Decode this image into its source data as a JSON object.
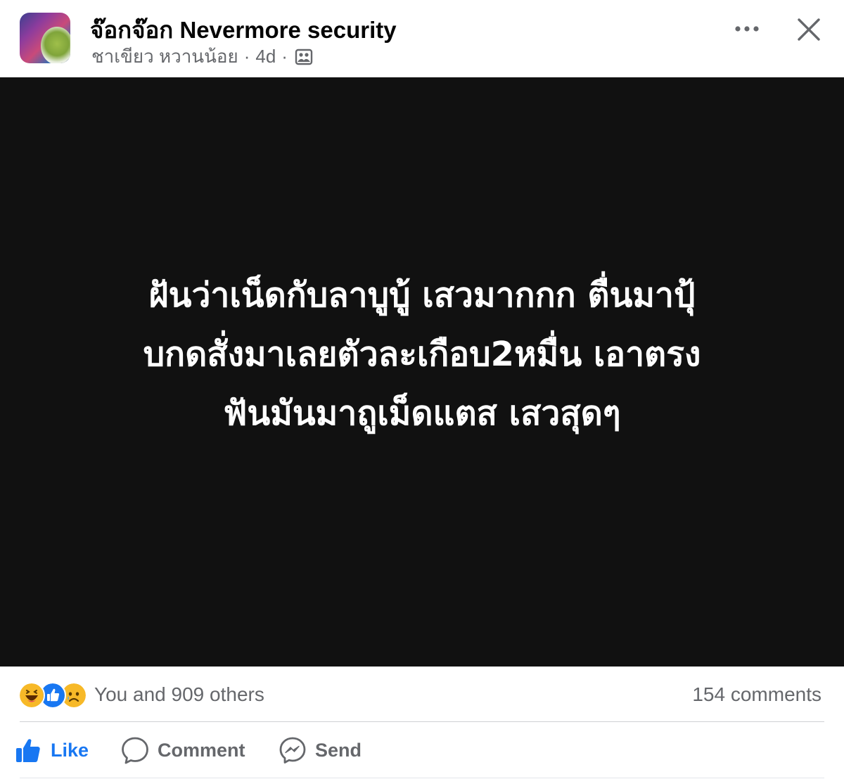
{
  "post": {
    "author": "จ๊อกจ๊อก Nevermore security",
    "group": "ชาเขียว หวานน้อย",
    "separator": "·",
    "time": "4d",
    "audience_icon": "group-audience-icon",
    "text_lines": [
      "ฝันว่าเน็ดกับลาบูบู้ เสวมากกก ตื่นมาปุ้",
      "บกดสั่งมาเลยตัวละเกือบ2หมื่น เอาตรง",
      "ฟันมันมาถูเม็ดแตส เสวสุดๆ"
    ],
    "background_color": "#111111"
  },
  "header": {
    "more_icon": "more-options-icon",
    "close_icon": "close-icon"
  },
  "reactions": {
    "icons": [
      "haha-reaction-icon",
      "like-reaction-icon",
      "sad-reaction-icon"
    ],
    "summary": "You and 909 others",
    "comments": "154 comments"
  },
  "actions": {
    "like_label": "Like",
    "comment_label": "Comment",
    "send_label": "Send"
  },
  "colors": {
    "accent": "#1877f2",
    "secondary_text": "#65676b"
  }
}
